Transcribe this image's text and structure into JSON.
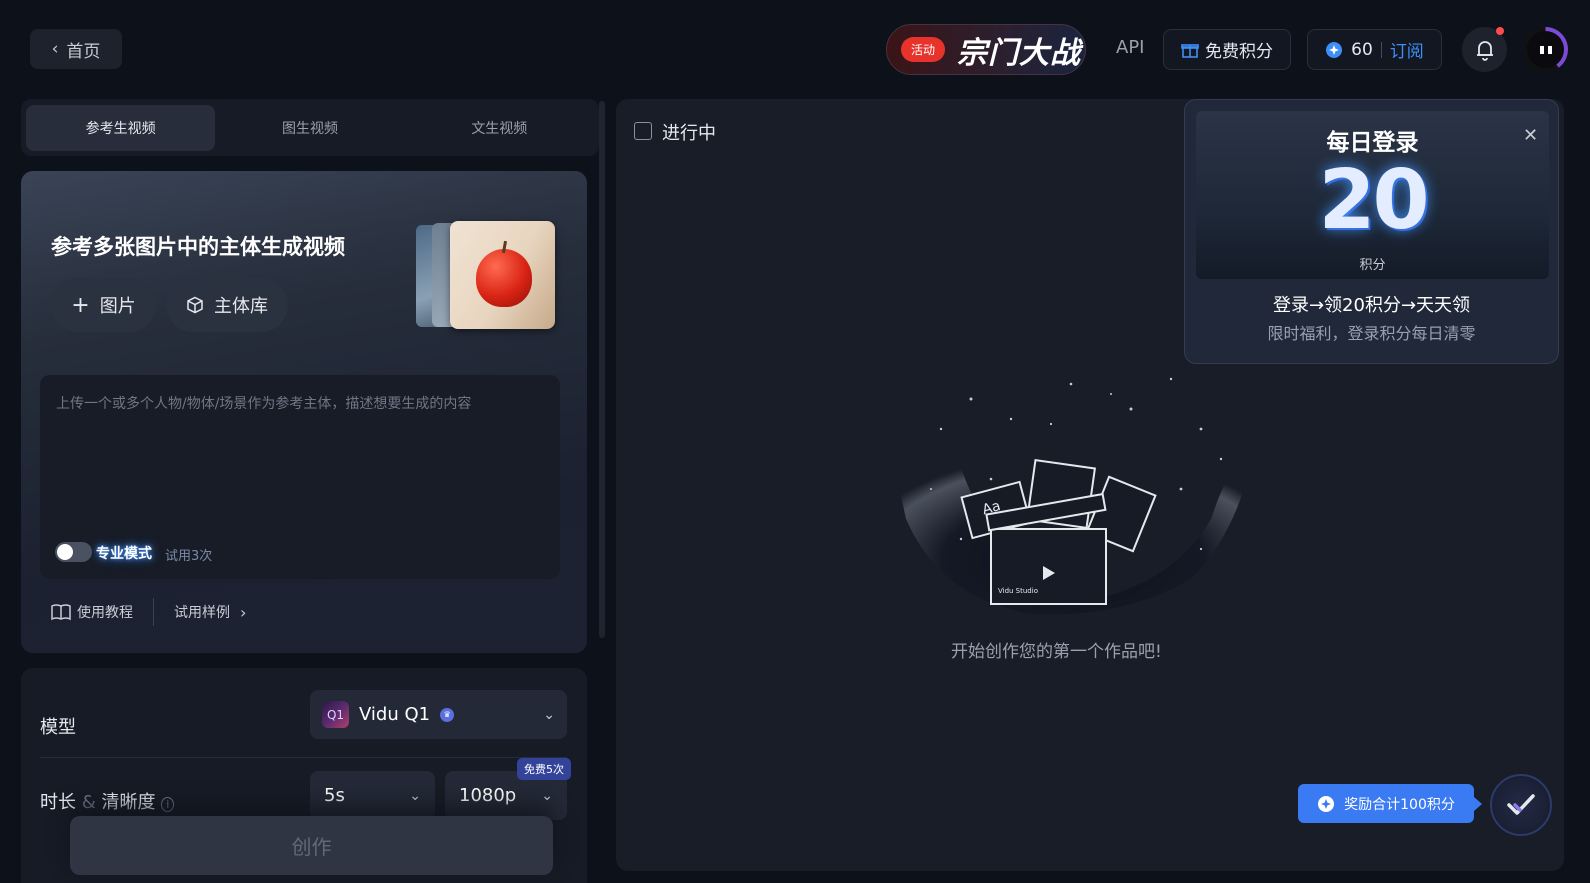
{
  "header": {
    "back_label": "首页",
    "promo_badge": "活动",
    "promo_title": "宗门大战",
    "api_label": "API",
    "free_credits_label": "免费积分",
    "credits_count": "60",
    "subscribe_label": "订阅"
  },
  "tabs": [
    {
      "label": "参考生视频",
      "active": true
    },
    {
      "label": "图生视频",
      "active": false
    },
    {
      "label": "文生视频",
      "active": false
    }
  ],
  "hero": {
    "title": "参考多张图片中的主体生成视频",
    "add_image_label": "图片",
    "subject_library_label": "主体库",
    "prompt_placeholder": "上传一个或多个人物/物体/场景作为参考主体，描述想要生成的内容",
    "pro_mode_label": "专业模式",
    "pro_mode_on": false,
    "trial_label": "试用3次",
    "tutorial_label": "使用教程",
    "examples_label": "试用样例"
  },
  "settings": {
    "model_label": "模型",
    "model_badge": "Q1",
    "model_name": "Vidu Q1",
    "duration_label_a": "时长",
    "duration_label_amp": "&",
    "duration_label_b": "清晰度",
    "duration_value": "5s",
    "resolution_value": "1080p",
    "free_tag": "免费5次",
    "create_label": "创作"
  },
  "main": {
    "in_progress_label": "进行中",
    "empty_text": "开始创作您的第一个作品吧!",
    "illustration_text": "Aa",
    "illustration_brand": "Vidu Studio"
  },
  "popup": {
    "title": "每日登录",
    "number": "20",
    "unit": "积分",
    "line1": "登录→领20积分→天天领",
    "line2": "限时福利，登录积分每日清零"
  },
  "reward": {
    "label": "奖励合计100积分"
  },
  "colors": {
    "background": "#0d111a",
    "panel": "#181d28",
    "accent": "#3f8ef7",
    "promo_red": "#e8332c"
  }
}
